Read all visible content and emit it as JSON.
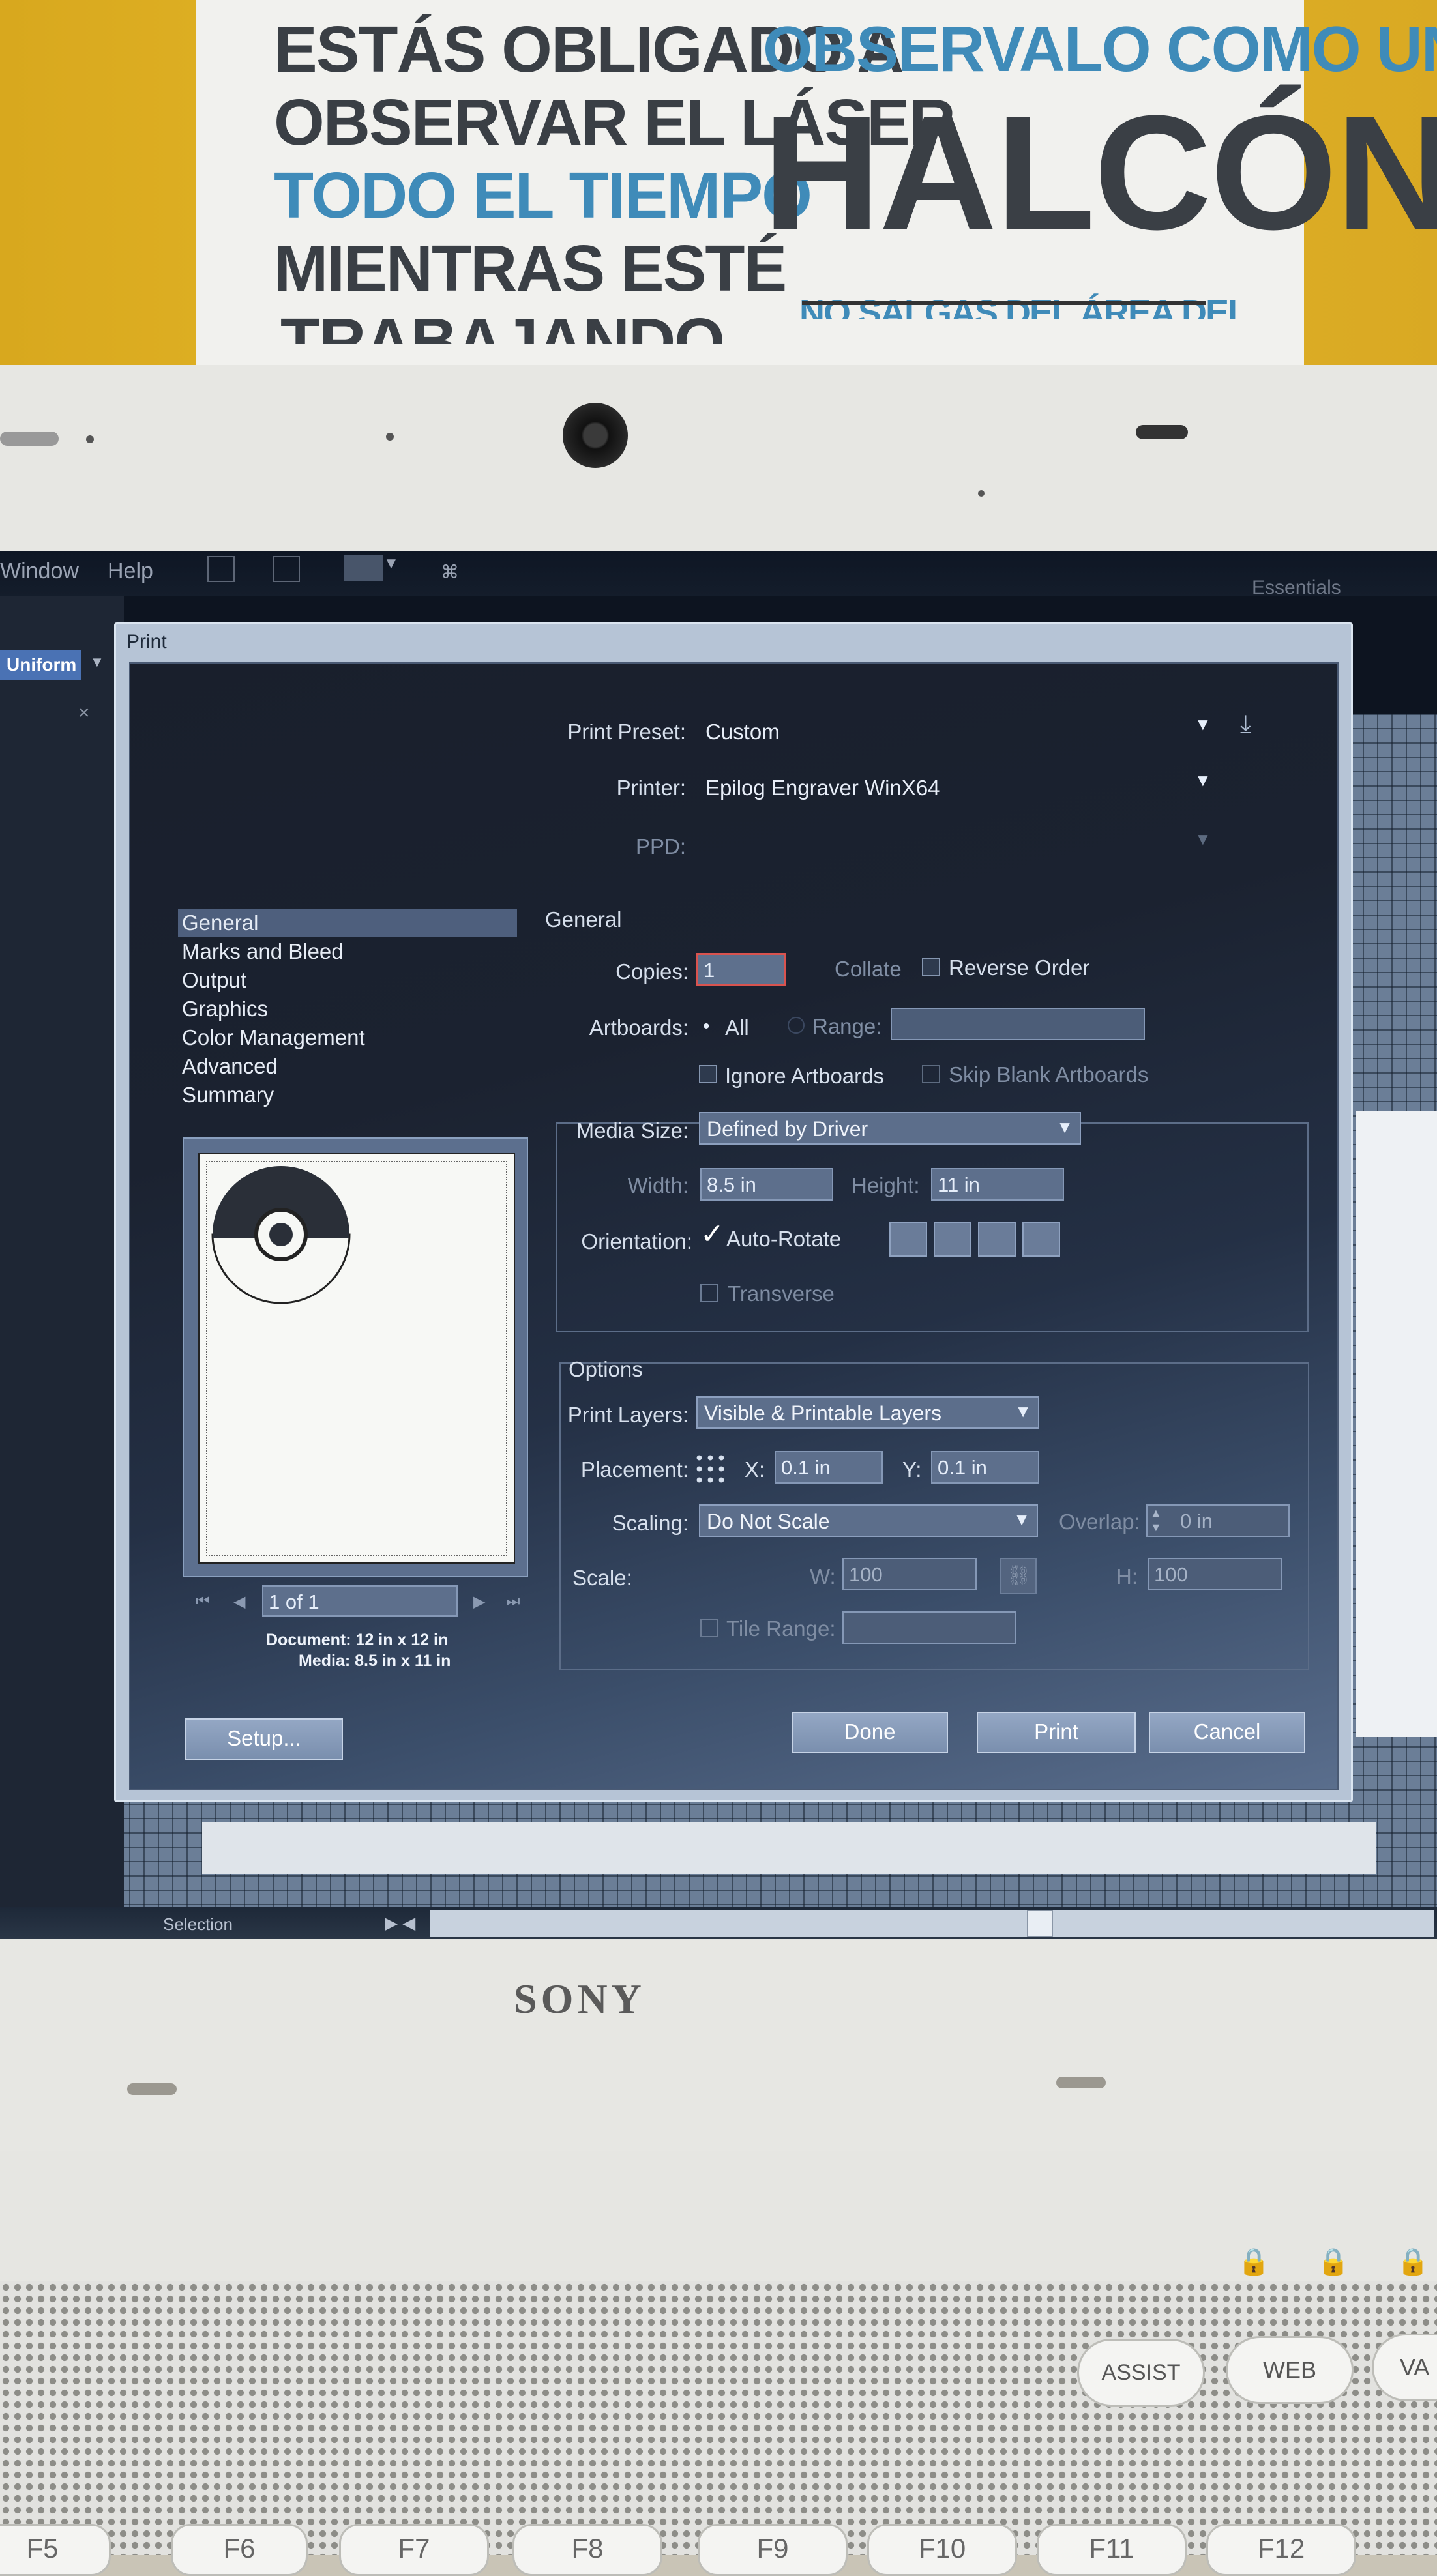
{
  "sign": {
    "left_lines": [
      "ESTÁS OBLIGADO A",
      "OBSERVAR EL LÁSER",
      "TODO EL TIEMPO",
      "MIENTRAS ESTÉ",
      "TRABAJANDO"
    ],
    "right_line1": "OBSERVALO COMO UN",
    "right_line2": "HALCÓN",
    "right_line3": "NO SALGAS DEL ÁREA DEL"
  },
  "app": {
    "menu": [
      "Window",
      "Help"
    ],
    "workspace": "Essentials",
    "uniform_label": "Uniform",
    "status_tool": "Selection"
  },
  "dialog": {
    "title": "Print",
    "print_preset_label": "Print Preset:",
    "print_preset_value": "Custom",
    "printer_label": "Printer:",
    "printer_value": "Epilog Engraver WinX64",
    "ppd_label": "PPD:",
    "categories": [
      "General",
      "Marks and Bleed",
      "Output",
      "Graphics",
      "Color Management",
      "Advanced",
      "Summary"
    ],
    "selected_category": "General",
    "section_title": "General",
    "copies_label": "Copies:",
    "copies_value": "1",
    "collate_label": "Collate",
    "reverse_order_label": "Reverse Order",
    "artboards_label": "Artboards:",
    "all_label": "All",
    "range_label": "Range:",
    "ignore_artboards_label": "Ignore Artboards",
    "skip_blank_label": "Skip Blank Artboards",
    "media_size_label": "Media Size:",
    "media_size_value": "Defined by Driver",
    "width_label": "Width:",
    "width_value": "8.5 in",
    "height_label": "Height:",
    "height_value": "11 in",
    "orientation_label": "Orientation:",
    "auto_rotate_label": "Auto-Rotate",
    "transverse_label": "Transverse",
    "options_title": "Options",
    "print_layers_label": "Print Layers:",
    "print_layers_value": "Visible & Printable Layers",
    "placement_label": "Placement:",
    "x_label": "X:",
    "x_value": "0.1 in",
    "y_label": "Y:",
    "y_value": "0.1 in",
    "scaling_label": "Scaling:",
    "scaling_value": "Do Not Scale",
    "overlap_label": "Overlap:",
    "overlap_value": "0 in",
    "scale_label": "Scale:",
    "w_label": "W:",
    "w_value": "100",
    "h_label": "H:",
    "h_value": "100",
    "tile_range_label": "Tile Range:",
    "page_counter": "1 of 1",
    "document_size": "Document: 12 in x 12 in",
    "media_size": "Media: 8.5 in x 11 in",
    "setup_button": "Setup...",
    "done_button": "Done",
    "print_button": "Print",
    "cancel_button": "Cancel"
  },
  "laptop": {
    "brand": "SONY",
    "keys_top": [
      "ASSIST",
      "WEB",
      "VA"
    ],
    "fkeys": [
      "F5",
      "F6",
      "F7",
      "F8",
      "F9",
      "F10",
      "F11",
      "F12"
    ]
  },
  "colors": {
    "sign_blue": "#3f8bb9",
    "sign_dark": "#3a3f45",
    "wall_yellow": "#e3b52a",
    "dialog_bg": "#1b2230",
    "laptop_white": "#e7e7e3"
  }
}
